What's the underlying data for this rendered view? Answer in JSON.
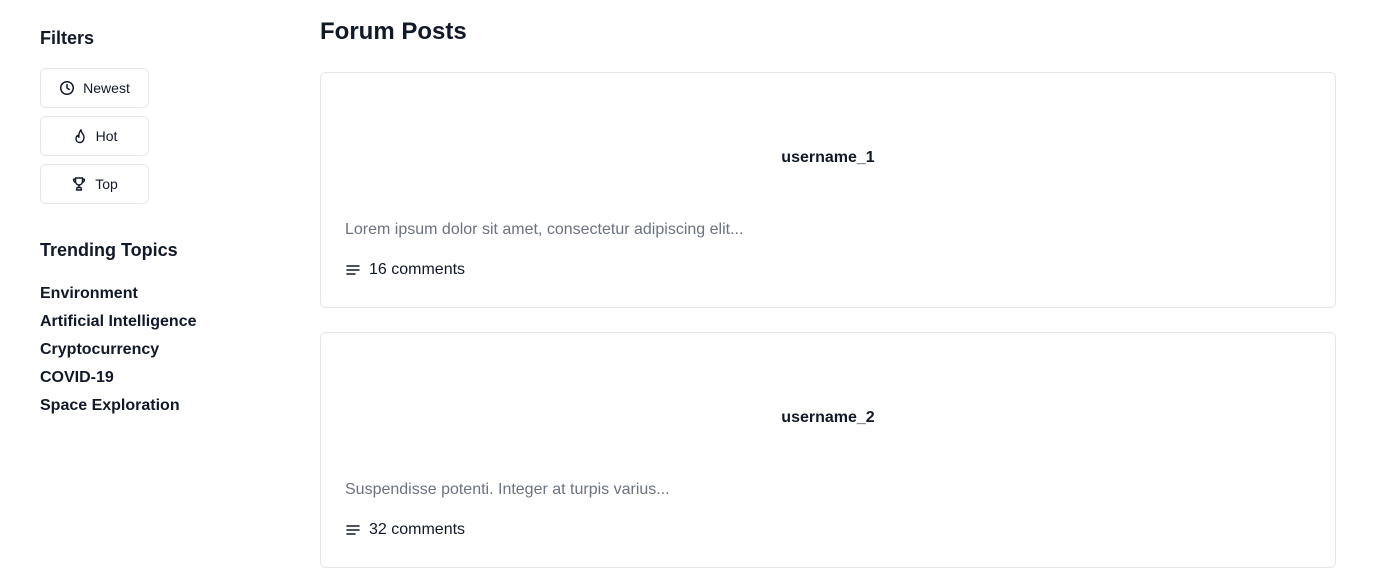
{
  "sidebar": {
    "filters_heading": "Filters",
    "filters": [
      {
        "label": "Newest",
        "icon": "clock-icon"
      },
      {
        "label": "Hot",
        "icon": "flame-icon"
      },
      {
        "label": "Top",
        "icon": "trophy-icon"
      }
    ],
    "trending_heading": "Trending Topics",
    "topics": [
      "Environment",
      "Artificial Intelligence",
      "Cryptocurrency",
      "COVID-19",
      "Space Exploration"
    ]
  },
  "main": {
    "title": "Forum Posts",
    "posts": [
      {
        "username": "username_1",
        "excerpt": "Lorem ipsum dolor sit amet, consectetur adipiscing elit...",
        "comments": "16 comments",
        "comments_icon": "text-lines-icon"
      },
      {
        "username": "username_2",
        "excerpt": "Suspendisse potenti. Integer at turpis varius...",
        "comments": "32 comments",
        "comments_icon": "text-lines-icon"
      }
    ]
  },
  "colors": {
    "text": "#111827",
    "muted": "#6b7280",
    "border": "#e5e7eb",
    "background": "#ffffff"
  }
}
